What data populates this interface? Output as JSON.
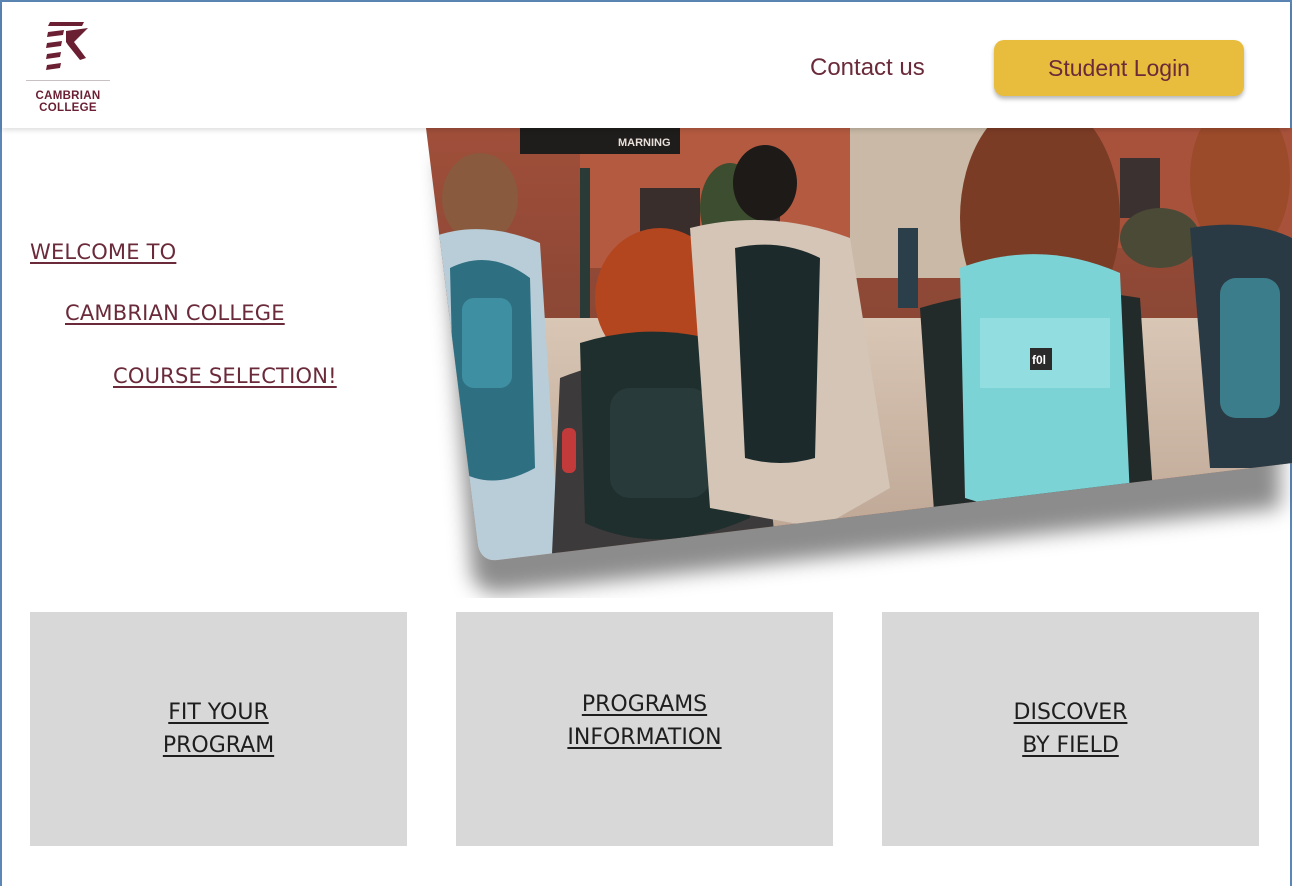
{
  "header": {
    "logo_text_line1": "CAMBRIAN",
    "logo_text_line2": "COLLEGE",
    "contact_label": "Contact us",
    "login_label": "Student Login"
  },
  "welcome": {
    "line1": "WELCOME TO",
    "line2": "CAMBRIAN COLLEGE",
    "line3": "COURSE SELECTION!"
  },
  "cards": [
    {
      "label": "FIT YOUR \nPROGRAM"
    },
    {
      "label": "PROGRAMS\nINFORMATION"
    },
    {
      "label": "DISCOVER\nBY FIELD"
    }
  ],
  "colors": {
    "brand": "#6a2a3a",
    "accent": "#e8bd3d",
    "card_bg": "#d8d8d8",
    "frame": "#5b86b5"
  },
  "hero": {
    "icon": "students-photo",
    "sign_text": "MARNING",
    "backpack_badge": "f0l"
  }
}
